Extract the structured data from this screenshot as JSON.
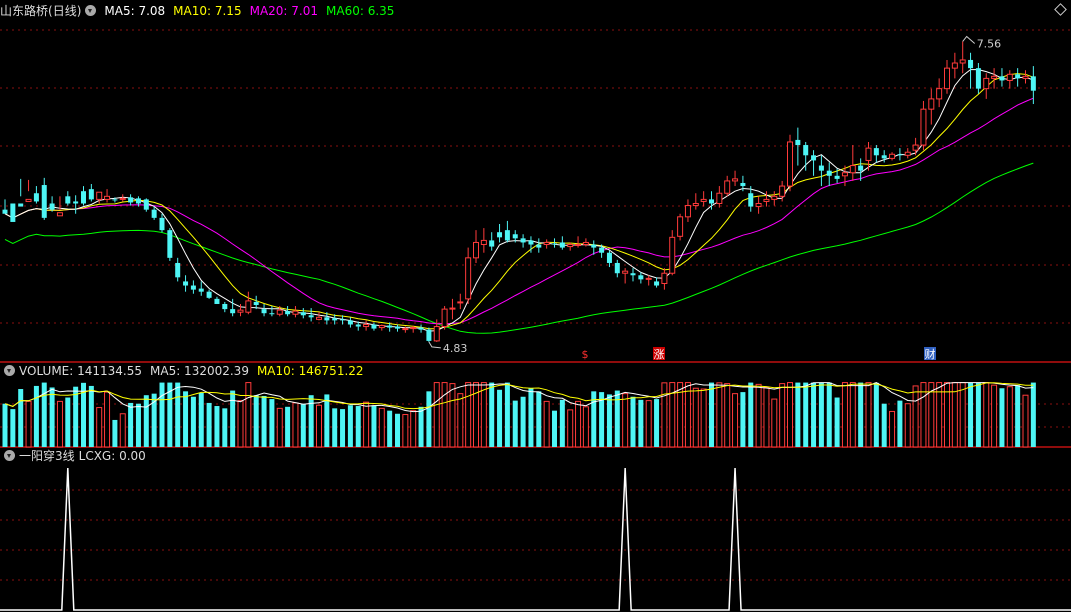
{
  "stock": {
    "name": "山东路桥",
    "period": "(日线)"
  },
  "price_panel": {
    "ma5": {
      "label": "MA5: 7.08",
      "color": "#ffffff"
    },
    "ma10": {
      "label": "MA10: 7.15",
      "color": "#ffff00"
    },
    "ma20": {
      "label": "MA20: 7.01",
      "color": "#ff00ff"
    },
    "ma60": {
      "label": "MA60: 6.35",
      "color": "#00ff00"
    },
    "high_label": "7.56",
    "low_label": "4.83",
    "markers": [
      {
        "text": "$",
        "color": "#ff3030"
      },
      {
        "text": "涨",
        "color": "#ffffff",
        "bg": "#cc0000"
      },
      {
        "text": "财",
        "color": "#ffffff",
        "bg": "#3060c0"
      }
    ]
  },
  "volume_panel": {
    "volume_label": "VOLUME: 141134.55",
    "ma5_label": "MA5: 132002.39",
    "ma10_label": "MA10: 146751.22"
  },
  "indicator_panel": {
    "name": "一阳穿3线",
    "value_label": "LCXG: 0.00"
  },
  "colors": {
    "up": "#ff3b3b",
    "down": "#4ef5f5",
    "grid": "#8a1010",
    "separator": "#c01010"
  },
  "chart_data": {
    "type": "candlestick",
    "price_range": [
      4.6,
      7.75
    ],
    "candles": [
      [
        5.92,
        6.02,
        5.88,
        5.9
      ],
      [
        5.98,
        5.95,
        5.8,
        5.86
      ],
      [
        5.98,
        6.22,
        5.95,
        6.05
      ],
      [
        6.0,
        6.21,
        6.02,
        6.1
      ],
      [
        6.08,
        6.15,
        6.0,
        5.98
      ],
      [
        6.16,
        6.23,
        5.84,
        5.82
      ],
      [
        5.98,
        6.05,
        5.92,
        5.9
      ],
      [
        5.86,
        6.05,
        5.89,
        5.92
      ],
      [
        6.05,
        6.1,
        5.98,
        5.96
      ],
      [
        6.0,
        6.06,
        5.98,
        5.88
      ],
      [
        6.1,
        6.15,
        5.98,
        5.96
      ],
      [
        6.12,
        6.17,
        6.02,
        6.0
      ],
      [
        6.02,
        6.05,
        6.09,
        5.98
      ],
      [
        6.02,
        6.12,
        6.05,
        5.99
      ],
      [
        6.02,
        6.04,
        6.01,
        5.99
      ],
      [
        6.02,
        6.07,
        6.03,
        6.0
      ],
      [
        6.04,
        6.07,
        5.99,
        5.96
      ],
      [
        6.03,
        6.05,
        5.98,
        5.95
      ],
      [
        6.02,
        6.03,
        5.92,
        5.9
      ],
      [
        5.92,
        5.95,
        5.84,
        5.82
      ],
      [
        5.84,
        5.88,
        5.72,
        5.7
      ],
      [
        5.72,
        5.74,
        5.45,
        5.42
      ],
      [
        5.4,
        5.45,
        5.26,
        5.22
      ],
      [
        5.22,
        5.28,
        5.18,
        5.12
      ],
      [
        5.18,
        5.23,
        5.14,
        5.1
      ],
      [
        5.15,
        5.22,
        5.12,
        5.08
      ],
      [
        5.12,
        5.14,
        5.06,
        5.05
      ],
      [
        5.05,
        5.07,
        5.0,
        5.0
      ],
      [
        5.0,
        5.02,
        4.95,
        4.92
      ],
      [
        4.95,
        5.05,
        4.91,
        4.88
      ],
      [
        4.92,
        5.0,
        4.94,
        4.88
      ],
      [
        4.92,
        5.12,
        5.03,
        4.9
      ],
      [
        5.02,
        5.08,
        4.99,
        4.95
      ],
      [
        4.95,
        5.0,
        4.91,
        4.88
      ],
      [
        4.91,
        4.98,
        4.9,
        4.88
      ],
      [
        4.9,
        4.98,
        4.94,
        4.88
      ],
      [
        4.93,
        4.98,
        4.9,
        4.88
      ],
      [
        4.9,
        4.98,
        4.93,
        4.87
      ],
      [
        4.92,
        4.96,
        4.89,
        4.86
      ],
      [
        4.89,
        4.96,
        4.87,
        4.83
      ],
      [
        4.85,
        4.92,
        4.87,
        4.84
      ],
      [
        4.87,
        4.92,
        4.84,
        4.8
      ],
      [
        4.86,
        4.9,
        4.84,
        4.8
      ],
      [
        4.85,
        4.89,
        4.84,
        4.8
      ],
      [
        4.84,
        4.87,
        4.8,
        4.77
      ],
      [
        4.8,
        4.83,
        4.78,
        4.74
      ],
      [
        4.78,
        4.84,
        4.8,
        4.74
      ],
      [
        4.8,
        4.82,
        4.76,
        4.74
      ],
      [
        4.77,
        4.8,
        4.79,
        4.74
      ],
      [
        4.79,
        4.82,
        4.77,
        4.73
      ],
      [
        4.78,
        4.8,
        4.76,
        4.73
      ],
      [
        4.76,
        4.78,
        4.76,
        4.72
      ],
      [
        4.76,
        4.79,
        4.77,
        4.72
      ],
      [
        4.77,
        4.8,
        4.75,
        4.72
      ],
      [
        4.75,
        4.77,
        4.64,
        4.63
      ],
      [
        4.64,
        4.85,
        4.78,
        4.63
      ],
      [
        4.78,
        4.98,
        4.95,
        4.75
      ],
      [
        4.95,
        5.05,
        4.96,
        4.85
      ],
      [
        5.02,
        5.1,
        5.02,
        4.95
      ],
      [
        5.05,
        5.55,
        5.45,
        5.0
      ],
      [
        5.45,
        5.72,
        5.6,
        5.4
      ],
      [
        5.58,
        5.74,
        5.62,
        5.5
      ],
      [
        5.62,
        5.7,
        5.56,
        5.52
      ],
      [
        5.7,
        5.78,
        5.65,
        5.6
      ],
      [
        5.72,
        5.81,
        5.62,
        5.6
      ],
      [
        5.68,
        5.72,
        5.64,
        5.6
      ],
      [
        5.64,
        5.68,
        5.6,
        5.55
      ],
      [
        5.62,
        5.66,
        5.58,
        5.5
      ],
      [
        5.58,
        5.64,
        5.55,
        5.5
      ],
      [
        5.58,
        5.63,
        5.6,
        5.54
      ],
      [
        5.59,
        5.64,
        5.58,
        5.55
      ],
      [
        5.6,
        5.66,
        5.55,
        5.53
      ],
      [
        5.56,
        5.6,
        5.58,
        5.52
      ],
      [
        5.58,
        5.66,
        5.58,
        5.55
      ],
      [
        5.58,
        5.64,
        5.6,
        5.56
      ],
      [
        5.58,
        5.62,
        5.55,
        5.48
      ],
      [
        5.55,
        5.58,
        5.5,
        5.45
      ],
      [
        5.5,
        5.52,
        5.4,
        5.36
      ],
      [
        5.4,
        5.43,
        5.3,
        5.26
      ],
      [
        5.3,
        5.35,
        5.32,
        5.2
      ],
      [
        5.3,
        5.35,
        5.28,
        5.22
      ],
      [
        5.28,
        5.31,
        5.24,
        5.2
      ],
      [
        5.24,
        5.28,
        5.25,
        5.18
      ],
      [
        5.22,
        5.26,
        5.18,
        5.16
      ],
      [
        5.2,
        5.35,
        5.3,
        5.14
      ],
      [
        5.3,
        5.72,
        5.65,
        5.28
      ],
      [
        5.66,
        5.88,
        5.85,
        5.62
      ],
      [
        5.85,
        6.02,
        5.96,
        5.8
      ],
      [
        5.96,
        6.08,
        5.98,
        5.92
      ],
      [
        6.0,
        6.1,
        6.02,
        5.95
      ],
      [
        6.02,
        6.1,
        5.98,
        5.92
      ],
      [
        5.98,
        6.15,
        6.08,
        5.94
      ],
      [
        6.08,
        6.25,
        6.2,
        6.05
      ],
      [
        6.2,
        6.3,
        6.22,
        6.15
      ],
      [
        6.18,
        6.25,
        6.15,
        6.1
      ],
      [
        6.08,
        6.15,
        5.95,
        5.9
      ],
      [
        5.95,
        6.05,
        5.98,
        5.88
      ],
      [
        6.0,
        6.1,
        6.02,
        5.95
      ],
      [
        6.02,
        6.1,
        6.05,
        5.96
      ],
      [
        6.05,
        6.2,
        6.15,
        6.0
      ],
      [
        6.15,
        6.65,
        6.58,
        6.1
      ],
      [
        6.6,
        6.72,
        6.55,
        6.35
      ],
      [
        6.55,
        6.58,
        6.45,
        6.3
      ],
      [
        6.45,
        6.5,
        6.4,
        6.25
      ],
      [
        6.35,
        6.45,
        6.3,
        6.15
      ],
      [
        6.3,
        6.38,
        6.25,
        6.15
      ],
      [
        6.25,
        6.32,
        6.22,
        6.18
      ],
      [
        6.25,
        6.35,
        6.28,
        6.15
      ],
      [
        6.28,
        6.55,
        6.35,
        6.2
      ],
      [
        6.35,
        6.42,
        6.3,
        6.2
      ],
      [
        6.4,
        6.58,
        6.52,
        6.3
      ],
      [
        6.52,
        6.55,
        6.45,
        6.38
      ],
      [
        6.45,
        6.5,
        6.42,
        6.38
      ],
      [
        6.42,
        6.48,
        6.46,
        6.4
      ],
      [
        6.46,
        6.52,
        6.45,
        6.4
      ],
      [
        6.45,
        6.52,
        6.48,
        6.42
      ],
      [
        6.5,
        6.62,
        6.55,
        6.45
      ],
      [
        6.55,
        6.98,
        6.9,
        6.5
      ],
      [
        6.9,
        7.1,
        7.0,
        6.75
      ],
      [
        7.0,
        7.2,
        7.1,
        6.92
      ],
      [
        7.1,
        7.38,
        7.3,
        7.05
      ],
      [
        7.3,
        7.45,
        7.35,
        7.2
      ],
      [
        7.35,
        7.56,
        7.38,
        7.25
      ],
      [
        7.38,
        7.45,
        7.3,
        7.1
      ],
      [
        7.3,
        7.35,
        7.1,
        7.05
      ],
      [
        7.1,
        7.25,
        7.2,
        7.0
      ],
      [
        7.2,
        7.3,
        7.22,
        7.1
      ],
      [
        7.22,
        7.3,
        7.18,
        7.12
      ],
      [
        7.18,
        7.28,
        7.24,
        7.1
      ],
      [
        7.24,
        7.3,
        7.2,
        7.12
      ],
      [
        7.2,
        7.28,
        7.22,
        7.15
      ],
      [
        7.22,
        7.32,
        7.08,
        6.95
      ]
    ],
    "volume_range": [
      0,
      260000
    ],
    "indicator_spikes": [
      8,
      79,
      93
    ]
  }
}
